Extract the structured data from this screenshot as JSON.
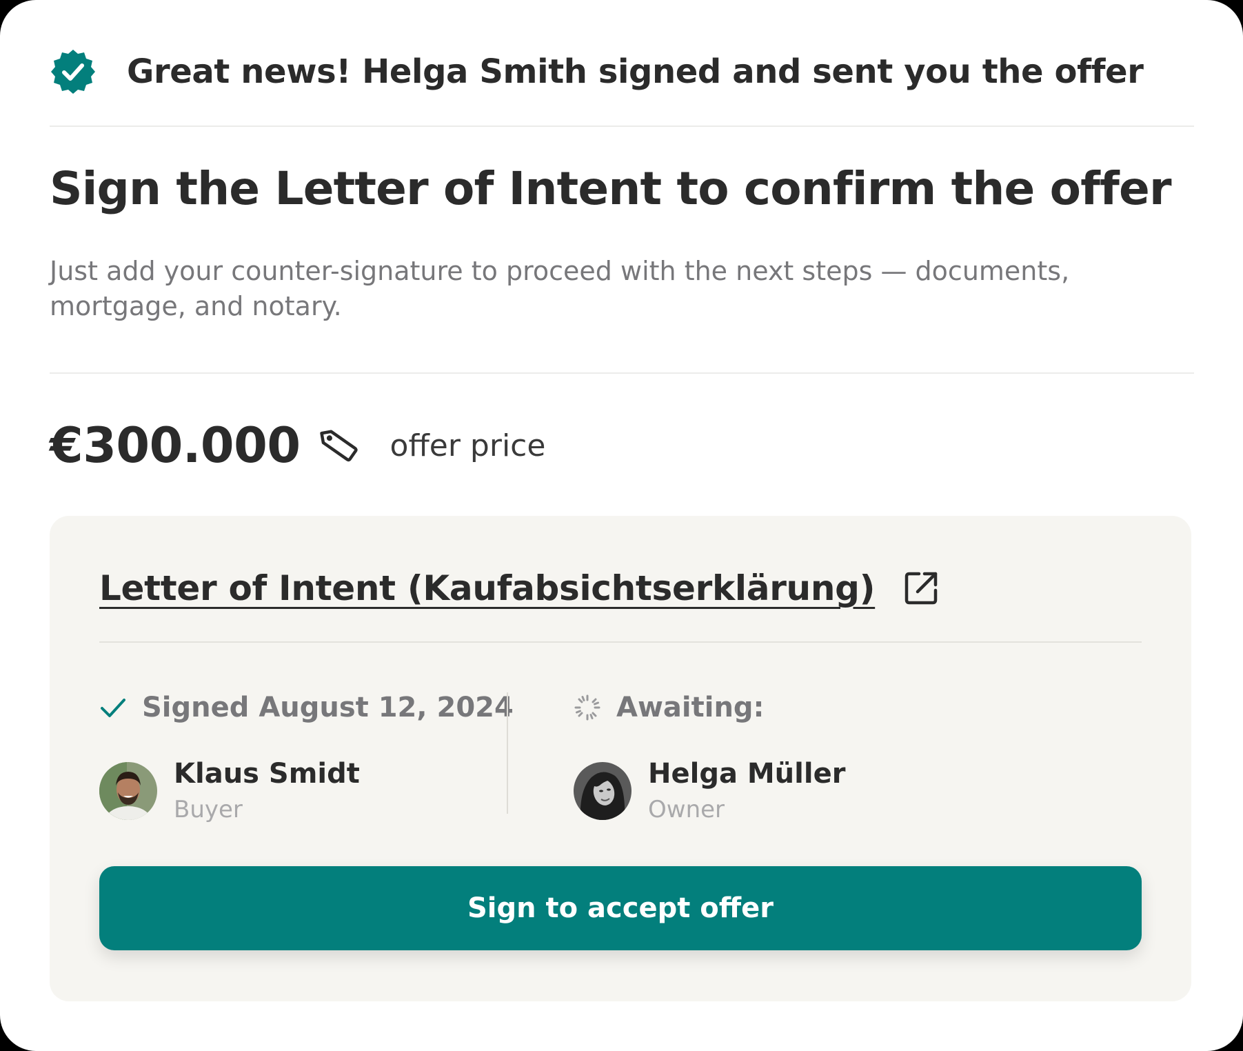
{
  "banner": {
    "text": "Great news! Helga Smith signed and sent you the offer",
    "icon": "verified-badge-icon"
  },
  "heading": "Sign the Letter of Intent to confirm the offer",
  "subtext": "Just add your counter-signature to proceed with the next steps — documents, mortgage, and notary.",
  "price": {
    "amount": "€300.000",
    "icon": "price-tag-icon",
    "label": "offer price"
  },
  "document": {
    "link_label": "Letter of Intent (Kaufabsichtserklärung)",
    "icon": "external-link-icon"
  },
  "signatories": {
    "signed": {
      "status": "Signed August 12, 2024",
      "icon": "checkmark-icon",
      "name": "Klaus Smidt",
      "role": "Buyer"
    },
    "awaiting": {
      "status": "Awaiting:",
      "icon": "loading-spinner-icon",
      "name": "Helga Müller",
      "role": "Owner"
    }
  },
  "action": {
    "button_label": "Sign to accept offer"
  },
  "colors": {
    "accent": "#037f7c",
    "card_background": "#f6f5f1",
    "muted_text": "#77777a"
  }
}
